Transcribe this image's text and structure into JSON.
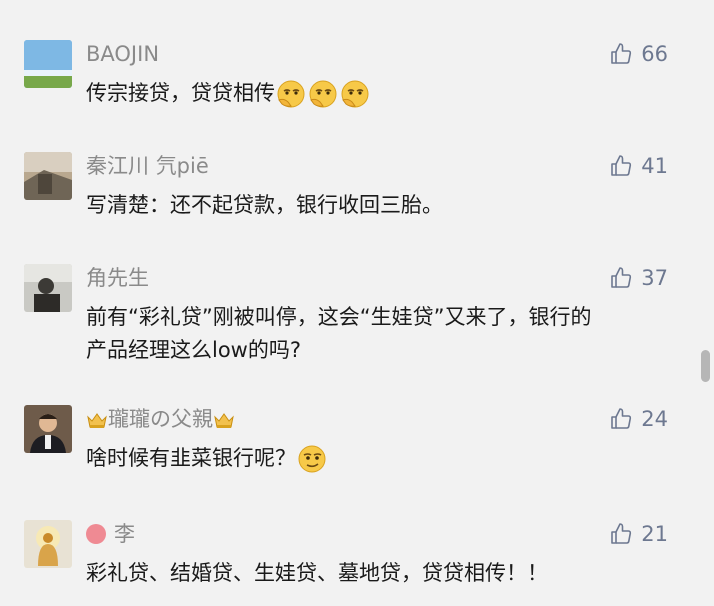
{
  "comments": [
    {
      "user": "BAOJIN",
      "likes": "66",
      "text": "传宗接贷，贷贷相传",
      "emoji": "smirk-hand-emoji x3"
    },
    {
      "user": "秦江川 氕piē",
      "likes": "41",
      "text": "写清楚：还不起贷款，银行收回三胎。"
    },
    {
      "user": "角先生",
      "likes": "37",
      "text_line1": "前有“彩礼贷”刚被叫停，这会“生娃贷”又来了，银行的",
      "text_line2": "产品经理这么low的吗?"
    },
    {
      "user": "瓏瓏の父親",
      "likes": "24",
      "text": "啥时候有韭菜银行呢？",
      "emoji": "smirk-emoji"
    },
    {
      "user": "李",
      "likes": "21",
      "text": "彩礼贷、结婚贷、生娃贷、墓地贷，贷贷相传！！"
    }
  ],
  "colors": {
    "background": "#f2f2f2",
    "username": "#8a8a8a",
    "like": "#6d7890",
    "text": "#1a1a1a"
  }
}
